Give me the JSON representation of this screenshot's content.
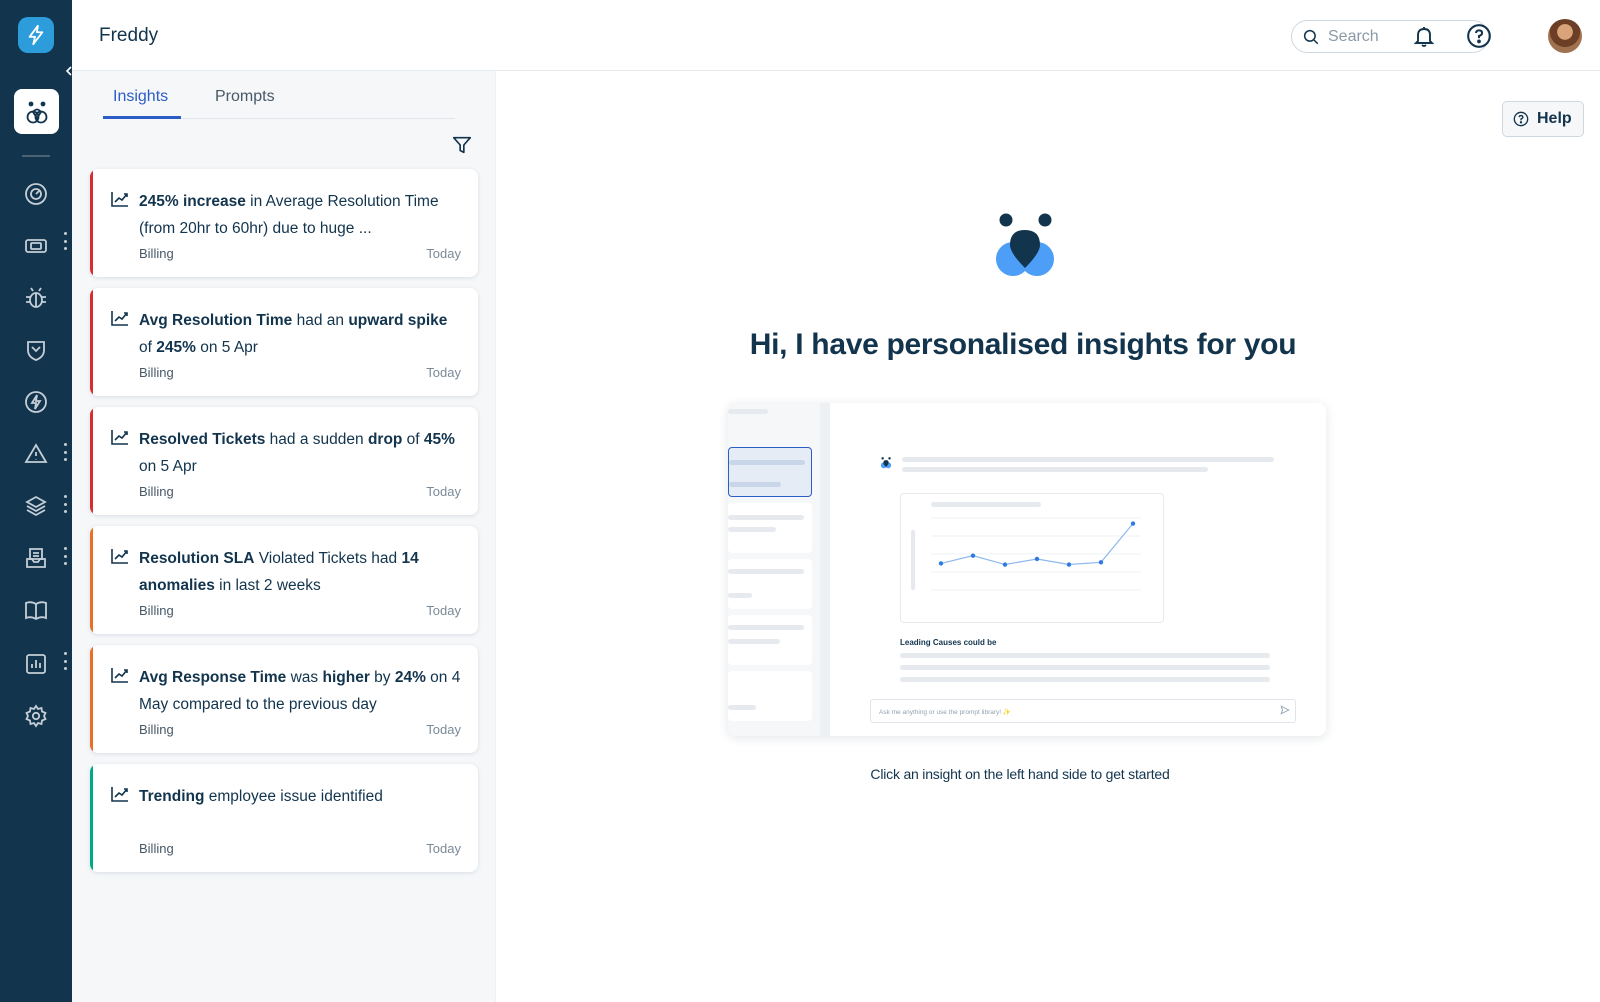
{
  "header": {
    "app_title": "Freddy",
    "search_placeholder": "Search"
  },
  "panel": {
    "tabs": [
      {
        "label": "Insights",
        "active": true
      },
      {
        "label": "Prompts",
        "active": false
      }
    ],
    "insights": [
      {
        "segments": [
          {
            "text": "245% increase",
            "bold": true
          },
          {
            "text": " in Average Resolution Time (from 20hr to 60hr) due to huge ...",
            "bold": false
          }
        ],
        "category": "Billing",
        "date": "Today",
        "accent": "#d72d30"
      },
      {
        "segments": [
          {
            "text": "Avg Resolution Time",
            "bold": true
          },
          {
            "text": " had an ",
            "bold": false
          },
          {
            "text": "upward spike",
            "bold": true
          },
          {
            "text": " of ",
            "bold": false
          },
          {
            "text": "245%",
            "bold": true
          },
          {
            "text": " on 5 Apr",
            "bold": false
          }
        ],
        "category": "Billing",
        "date": "Today",
        "accent": "#d72d30"
      },
      {
        "segments": [
          {
            "text": "Resolved Tickets",
            "bold": true
          },
          {
            "text": " had a sudden ",
            "bold": false
          },
          {
            "text": "drop",
            "bold": true
          },
          {
            "text": " of ",
            "bold": false
          },
          {
            "text": "45%",
            "bold": true
          },
          {
            "text": " on 5 Apr",
            "bold": false
          }
        ],
        "category": "Billing",
        "date": "Today",
        "accent": "#d72d30"
      },
      {
        "segments": [
          {
            "text": "Resolution SLA",
            "bold": true
          },
          {
            "text": " Violated Tickets had ",
            "bold": false
          },
          {
            "text": "14 anomalies",
            "bold": true
          },
          {
            "text": " in last 2 weeks",
            "bold": false
          }
        ],
        "category": "Billing",
        "date": "Today",
        "accent": "#e86f25"
      },
      {
        "segments": [
          {
            "text": "Avg Response Time",
            "bold": true
          },
          {
            "text": " was ",
            "bold": false
          },
          {
            "text": "higher",
            "bold": true
          },
          {
            "text": " by ",
            "bold": false
          },
          {
            "text": "24%",
            "bold": true
          },
          {
            "text": " on 4 May compared to the previous day",
            "bold": false
          }
        ],
        "category": "Billing",
        "date": "Today",
        "accent": "#e86f25"
      },
      {
        "segments": [
          {
            "text": "Trending",
            "bold": true
          },
          {
            "text": " employee issue identified",
            "bold": false
          }
        ],
        "category": "Billing",
        "date": "Today",
        "accent": "#00a886"
      }
    ]
  },
  "main": {
    "help_label": "Help",
    "headline": "Hi, I have personalised insights for you",
    "subline": "Click an insight on the left hand side to get started",
    "preview": {
      "caption": "Leading Causes could be",
      "ask_placeholder": "Ask me anything or use the prompt library! ✨",
      "chart_y": [
        48,
        62,
        46,
        56,
        46,
        50,
        120
      ]
    }
  },
  "colors": {
    "navy": "#12344d",
    "link_blue": "#2c5cc5",
    "freddy_light": "#4d9ef7",
    "freddy_dark": "#12344d"
  }
}
